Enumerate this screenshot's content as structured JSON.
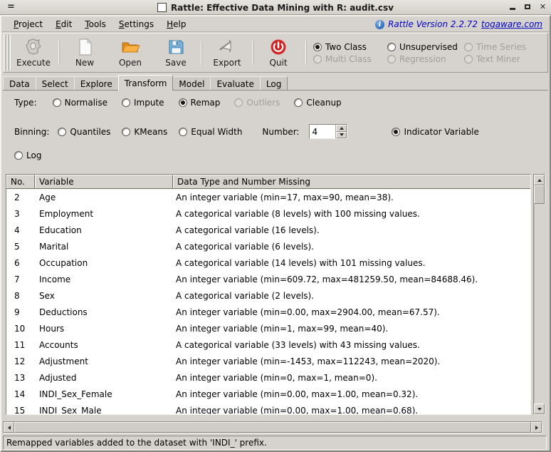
{
  "window": {
    "title": "Rattle: Effective Data Mining with R: audit.csv",
    "menu_glyph": "=",
    "minimize_label": "Minimize",
    "maximize_label": "Maximize",
    "close_label": "Close"
  },
  "menubar": {
    "items": [
      "Project",
      "Edit",
      "Tools",
      "Settings",
      "Help"
    ],
    "version_text": "Rattle Version 2.2.72",
    "link_text": "togaware.com",
    "info_glyph": "i"
  },
  "toolbar": {
    "buttons": [
      {
        "label": "Execute",
        "icon": "gear-icon"
      },
      {
        "label": "New",
        "icon": "new-document-icon"
      },
      {
        "label": "Open",
        "icon": "open-folder-icon"
      },
      {
        "label": "Save",
        "icon": "save-disk-icon"
      },
      {
        "label": "Export",
        "icon": "export-icon"
      },
      {
        "label": "Quit",
        "icon": "power-quit-icon"
      }
    ],
    "mode_radios_row1": [
      {
        "label": "Two Class",
        "checked": true,
        "disabled": false
      },
      {
        "label": "Unsupervised",
        "checked": false,
        "disabled": false
      },
      {
        "label": "Time Series",
        "checked": false,
        "disabled": true
      }
    ],
    "mode_radios_row2": [
      {
        "label": "Multi Class",
        "checked": false,
        "disabled": true
      },
      {
        "label": "Regression",
        "checked": false,
        "disabled": true
      },
      {
        "label": "Text Miner",
        "checked": false,
        "disabled": true
      }
    ]
  },
  "tabs": [
    {
      "label": "Data",
      "active": false
    },
    {
      "label": "Select",
      "active": false
    },
    {
      "label": "Explore",
      "active": false
    },
    {
      "label": "Transform",
      "active": true
    },
    {
      "label": "Model",
      "active": false
    },
    {
      "label": "Evaluate",
      "active": false
    },
    {
      "label": "Log",
      "active": false
    }
  ],
  "transform": {
    "type_label": "Type:",
    "type_options": [
      {
        "label": "Normalise",
        "checked": false,
        "disabled": false
      },
      {
        "label": "Impute",
        "checked": false,
        "disabled": false
      },
      {
        "label": "Remap",
        "checked": true,
        "disabled": false
      },
      {
        "label": "Outliers",
        "checked": false,
        "disabled": true
      },
      {
        "label": "Cleanup",
        "checked": false,
        "disabled": false
      }
    ],
    "binning_label": "Binning:",
    "binning_options": [
      {
        "label": "Quantiles",
        "checked": false,
        "disabled": false
      },
      {
        "label": "KMeans",
        "checked": false,
        "disabled": false
      },
      {
        "label": "Equal Width",
        "checked": false,
        "disabled": false
      }
    ],
    "number_label": "Number:",
    "number_value": "4",
    "indicator_option": {
      "label": "Indicator Variable",
      "checked": true,
      "disabled": false
    },
    "log_option": {
      "label": "Log",
      "checked": false,
      "disabled": false
    }
  },
  "table": {
    "headers": [
      "No.",
      "Variable",
      "Data Type and Number Missing"
    ],
    "rows": [
      {
        "no": "2",
        "variable": "Age",
        "desc": "An integer variable (min=17, max=90, mean=38)."
      },
      {
        "no": "3",
        "variable": "Employment",
        "desc": "A categorical variable (8 levels) with 100 missing values."
      },
      {
        "no": "4",
        "variable": "Education",
        "desc": "A categorical variable (16 levels)."
      },
      {
        "no": "5",
        "variable": "Marital",
        "desc": "A categorical variable (6 levels)."
      },
      {
        "no": "6",
        "variable": "Occupation",
        "desc": "A categorical variable (14 levels) with 101 missing values."
      },
      {
        "no": "7",
        "variable": "Income",
        "desc": "An integer variable (min=609.72, max=481259.50, mean=84688.46)."
      },
      {
        "no": "8",
        "variable": "Sex",
        "desc": "A categorical variable (2 levels)."
      },
      {
        "no": "9",
        "variable": "Deductions",
        "desc": "An integer variable (min=0.00, max=2904.00, mean=67.57)."
      },
      {
        "no": "10",
        "variable": "Hours",
        "desc": "An integer variable (min=1, max=99, mean=40)."
      },
      {
        "no": "11",
        "variable": "Accounts",
        "desc": "A categorical variable (33 levels) with 43 missing values."
      },
      {
        "no": "12",
        "variable": "Adjustment",
        "desc": "An integer variable (min=-1453, max=112243, mean=2020)."
      },
      {
        "no": "13",
        "variable": "Adjusted",
        "desc": "An integer variable (min=0, max=1, mean=0)."
      },
      {
        "no": "14",
        "variable": "INDI_Sex_Female",
        "desc": "An integer variable (min=0.00, max=1.00, mean=0.32)."
      },
      {
        "no": "15",
        "variable": "INDI_Sex_Male",
        "desc": "An integer variable (min=0.00, max=1.00, mean=0.68)."
      }
    ]
  },
  "statusbar": {
    "message": "Remapped variables added to the dataset with 'INDI_' prefix."
  },
  "colors": {
    "window_bg": "#d6d3ce",
    "link": "#0000c8",
    "quit_red": "#d41a1a",
    "folder_orange": "#f0a23c",
    "disk_blue": "#5f9fd0"
  }
}
